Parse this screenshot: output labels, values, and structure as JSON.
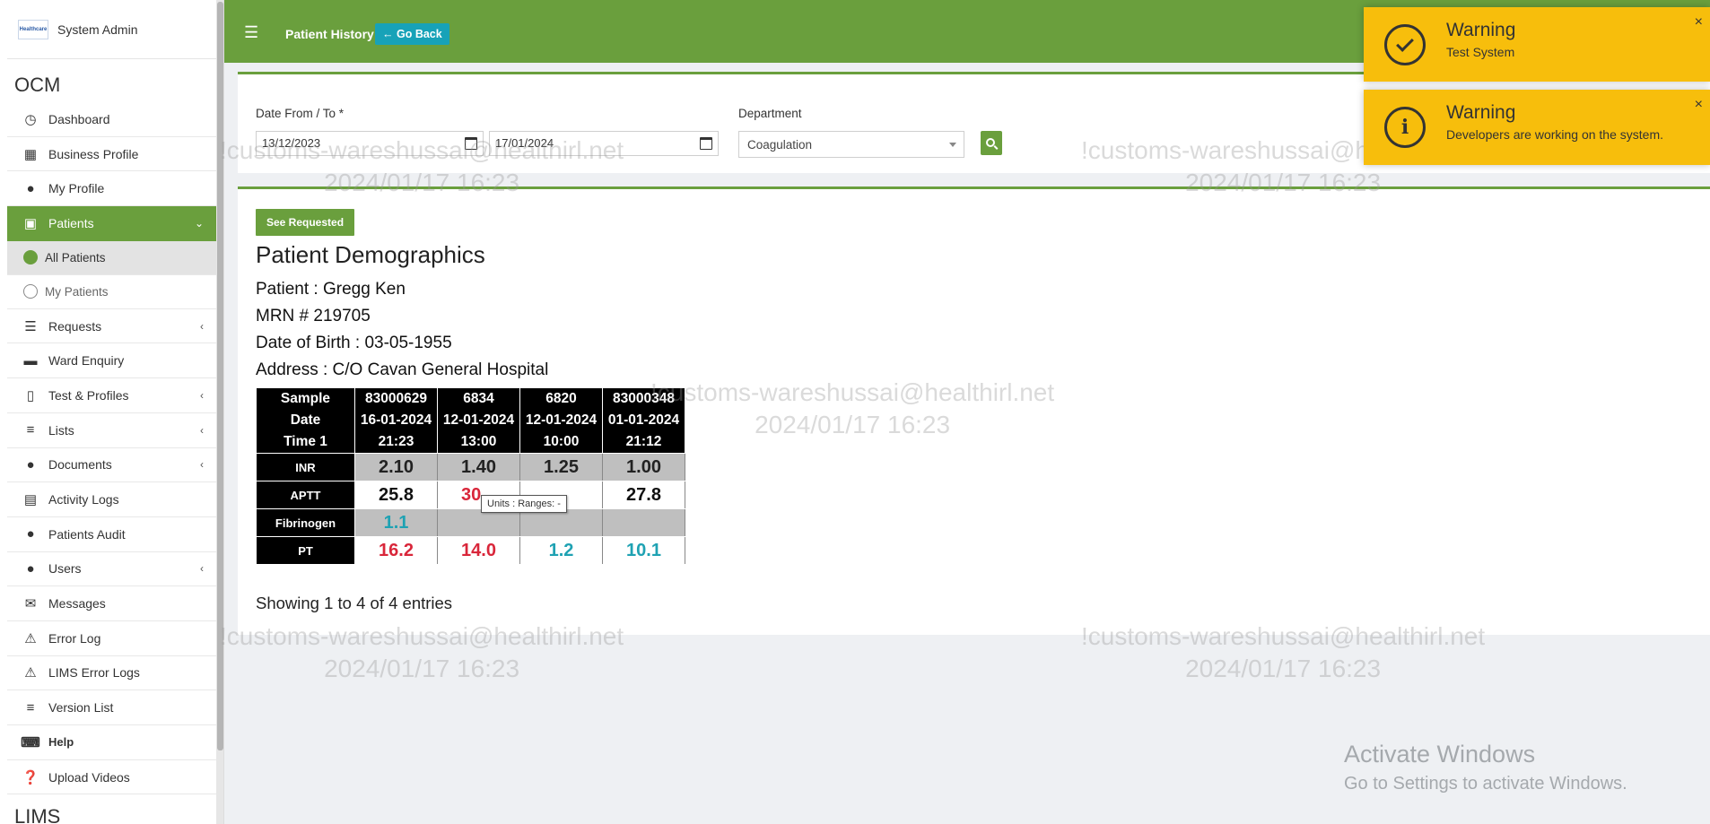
{
  "sidebar": {
    "user_name": "System Admin",
    "logo_text": "Healthcare",
    "brand": "OCM",
    "items": [
      {
        "label": "Dashboard",
        "icon": "dashboard-icon"
      },
      {
        "label": "Business Profile",
        "icon": "building-icon"
      },
      {
        "label": "My Profile",
        "icon": "user-icon"
      },
      {
        "label": "Patients",
        "icon": "patients-icon",
        "active": true
      },
      {
        "label": "All Patients",
        "sub": true,
        "selected": true
      },
      {
        "label": "My Patients",
        "sub": true
      },
      {
        "label": "Requests",
        "icon": "database-icon"
      },
      {
        "label": "Ward Enquiry",
        "icon": "bed-icon"
      },
      {
        "label": "Test & Profiles",
        "icon": "test-tubes-icon"
      },
      {
        "label": "Lists",
        "icon": "list-icon"
      },
      {
        "label": "Documents",
        "icon": "users-icon"
      },
      {
        "label": "Activity Logs",
        "icon": "activity-icon"
      },
      {
        "label": "Patients Audit",
        "icon": "users-audit-icon"
      },
      {
        "label": "Users",
        "icon": "users-group-icon"
      },
      {
        "label": "Messages",
        "icon": "envelope-icon"
      },
      {
        "label": "Error Log",
        "icon": "warning-icon"
      },
      {
        "label": "LIMS Error Logs",
        "icon": "warning-icon"
      },
      {
        "label": "Version List",
        "icon": "list-icon"
      },
      {
        "label": "Help",
        "icon": "keyboard-icon"
      },
      {
        "label": "Upload Videos",
        "icon": "question-icon"
      }
    ],
    "section_bottom": "LIMS"
  },
  "topbar": {
    "title": "Patient History",
    "go_back": "Go Back"
  },
  "filter": {
    "date_label": "Date From / To *",
    "date_from": "13/12/2023",
    "date_to": "17/01/2024",
    "department_label": "Department",
    "department_value": "Coagulation"
  },
  "content": {
    "see_requested": "See Requested",
    "demographics_title": "Patient Demographics",
    "patient": "Patient : Gregg Ken",
    "mrn": "MRN # 219705",
    "dob": "Date of Birth : 03-05-1955",
    "address": "Address : C/O Cavan General Hospital",
    "table": {
      "header_labels": [
        "Sample",
        "Date",
        "Time 1"
      ],
      "columns": [
        {
          "sample": "83000629",
          "date": "16-01-2024",
          "time": "21:23"
        },
        {
          "sample": "6834",
          "date": "12-01-2024",
          "time": "13:00"
        },
        {
          "sample": "6820",
          "date": "12-01-2024",
          "time": "10:00"
        },
        {
          "sample": "83000348",
          "date": "01-01-2024",
          "time": "21:12"
        }
      ],
      "rows": [
        {
          "label": "INR",
          "values": [
            "2.10",
            "1.40",
            "1.25",
            "1.00"
          ]
        },
        {
          "label": "APTT",
          "values": [
            "25.8",
            "30",
            "",
            "27.8"
          ]
        },
        {
          "label": "Fibrinogen",
          "values": [
            "1.1",
            "",
            "",
            ""
          ]
        },
        {
          "label": "PT",
          "values": [
            "16.2",
            "14.0",
            "1.2",
            "10.1"
          ]
        }
      ]
    },
    "tooltip": "Units :  Ranges: -",
    "entries_text": "Showing 1 to 4 of 4 entries"
  },
  "toasts": [
    {
      "title": "Warning",
      "message": "Test System",
      "icon": "check-circle-icon"
    },
    {
      "title": "Warning",
      "message": "Developers are working on the system.",
      "icon": "info-circle-icon"
    }
  ],
  "watermark": {
    "line1": "!customs-wareshussai@healthirl.net",
    "line2": "2024/01/17 16:23"
  },
  "os_overlay": {
    "line1": "Activate Windows",
    "line2": "Go to Settings to activate Windows."
  },
  "colors": {
    "primary": "#6a9f3d",
    "info": "#17a2b8",
    "warning": "#f7be0c",
    "danger": "#d9263a",
    "teal_value": "#1fa2b3"
  }
}
